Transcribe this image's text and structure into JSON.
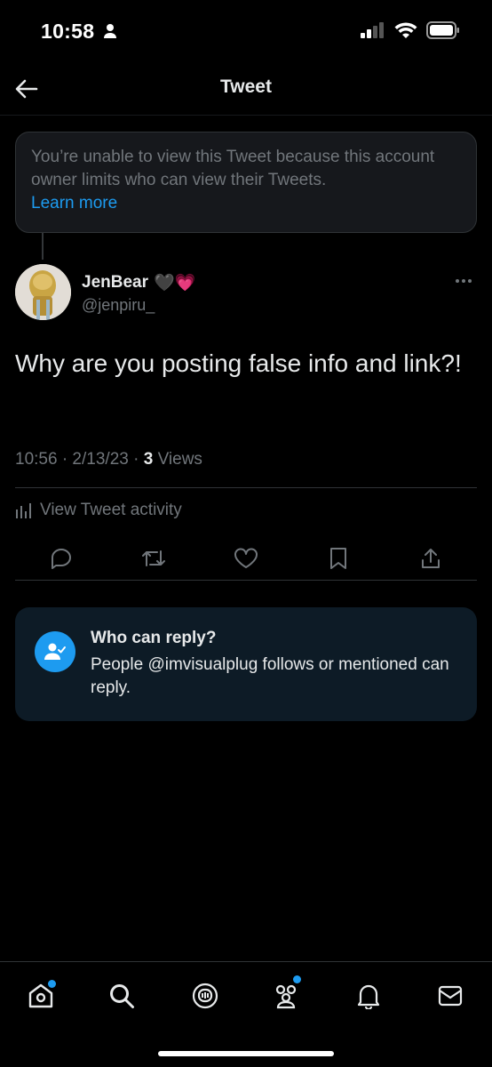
{
  "status_bar": {
    "time": "10:58"
  },
  "header": {
    "title": "Tweet"
  },
  "unavailable": {
    "message": "You’re unable to view this Tweet because this account owner limits who can view their Tweets.",
    "link": "Learn more"
  },
  "tweet": {
    "author_name": "JenBear",
    "emoji": "🖤💗",
    "handle": "@jenpiru_",
    "text": "Why are you posting false info and link?!",
    "time": "10:56 · 2/13/23 · ",
    "views_count": "3",
    "views_label": " Views",
    "activity_label": "View Tweet activity"
  },
  "who_can_reply": {
    "title": "Who can reply?",
    "description": "People @imvisualplug follows or mentioned can reply."
  },
  "colors": {
    "accent": "#1d9bf0",
    "muted": "#71767b",
    "text": "#e7e9ea",
    "card": "#16181c",
    "reply_card": "#0d1b26"
  },
  "icons": {
    "status": [
      "person-icon",
      "signal-icon",
      "wifi-icon",
      "battery-icon"
    ],
    "actions": [
      "reply-icon",
      "retweet-icon",
      "like-icon",
      "bookmark-icon",
      "share-icon"
    ],
    "tabs": [
      "home-icon",
      "search-icon",
      "spaces-icon",
      "communities-icon",
      "notifications-icon",
      "messages-icon"
    ]
  }
}
